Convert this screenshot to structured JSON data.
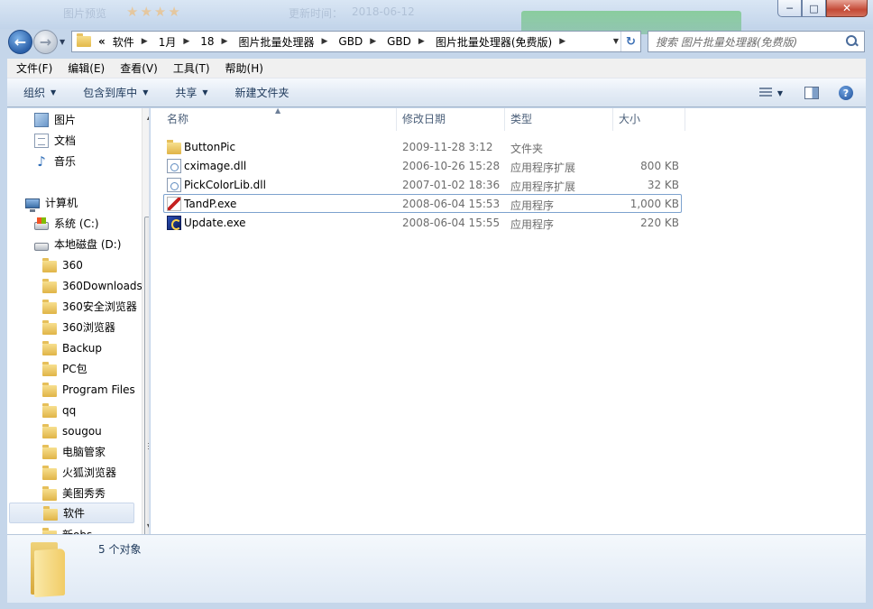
{
  "window": {
    "ghost_title_1": "图片预览",
    "ghost_title_2": "更新时间：",
    "ghost_title_3": "2018-06-12",
    "ghost_stars": "★★★★",
    "minimize_glyph": "─",
    "maximize_glyph": "□",
    "close_glyph": "✕"
  },
  "nav": {
    "back_glyph": "←",
    "forward_glyph": "→",
    "overflow": "«",
    "breadcrumbs": [
      "软件",
      "1月",
      "18",
      "图片批量处理器",
      "GBD",
      "GBD",
      "图片批量处理器(免费版)"
    ],
    "refresh_glyph": "↻",
    "search_placeholder": "搜索 图片批量处理器(免费版)"
  },
  "menubar": {
    "items": [
      "文件(F)",
      "编辑(E)",
      "查看(V)",
      "工具(T)",
      "帮助(H)"
    ]
  },
  "commandbar": {
    "organize": "组织",
    "include_in_library": "包含到库中",
    "share": "共享",
    "new_folder": "新建文件夹",
    "help_glyph": "?"
  },
  "sidebar": {
    "favorites": [
      {
        "label": "图片",
        "icon": "pictures-icon"
      },
      {
        "label": "文档",
        "icon": "documents-icon"
      },
      {
        "label": "音乐",
        "icon": "music-icon"
      }
    ],
    "computer_label": "计算机",
    "drives": [
      {
        "label": "系统 (C:)",
        "icon": "system-drive-icon"
      },
      {
        "label": "本地磁盘 (D:)",
        "icon": "local-disk-icon"
      }
    ],
    "folders": [
      "360",
      "360Downloads",
      "360安全浏览器",
      "360浏览器",
      "Backup",
      "PC包",
      "Program Files",
      "qq",
      "sougou",
      "电脑管家",
      "火狐浏览器",
      "美图秀秀",
      "软件",
      "新obs"
    ],
    "selected_folder": "软件"
  },
  "filelist": {
    "columns": {
      "name": "名称",
      "date": "修改日期",
      "type": "类型",
      "size": "大小"
    },
    "rows": [
      {
        "name": "ButtonPic",
        "date": "2009-11-28 3:12",
        "type": "文件夹",
        "size": "",
        "icon": "folder-icon"
      },
      {
        "name": "cximage.dll",
        "date": "2006-10-26 15:28",
        "type": "应用程序扩展",
        "size": "800 KB",
        "icon": "dll-icon"
      },
      {
        "name": "PickColorLib.dll",
        "date": "2007-01-02 18:36",
        "type": "应用程序扩展",
        "size": "32 KB",
        "icon": "dll-icon"
      },
      {
        "name": "TandP.exe",
        "date": "2008-06-04 15:53",
        "type": "应用程序",
        "size": "1,000 KB",
        "icon": "tandp-exe-icon"
      },
      {
        "name": "Update.exe",
        "date": "2008-06-04 15:55",
        "type": "应用程序",
        "size": "220 KB",
        "icon": "update-exe-icon"
      }
    ],
    "focused_row": "TandP.exe"
  },
  "details": {
    "count": "5 个对象"
  }
}
